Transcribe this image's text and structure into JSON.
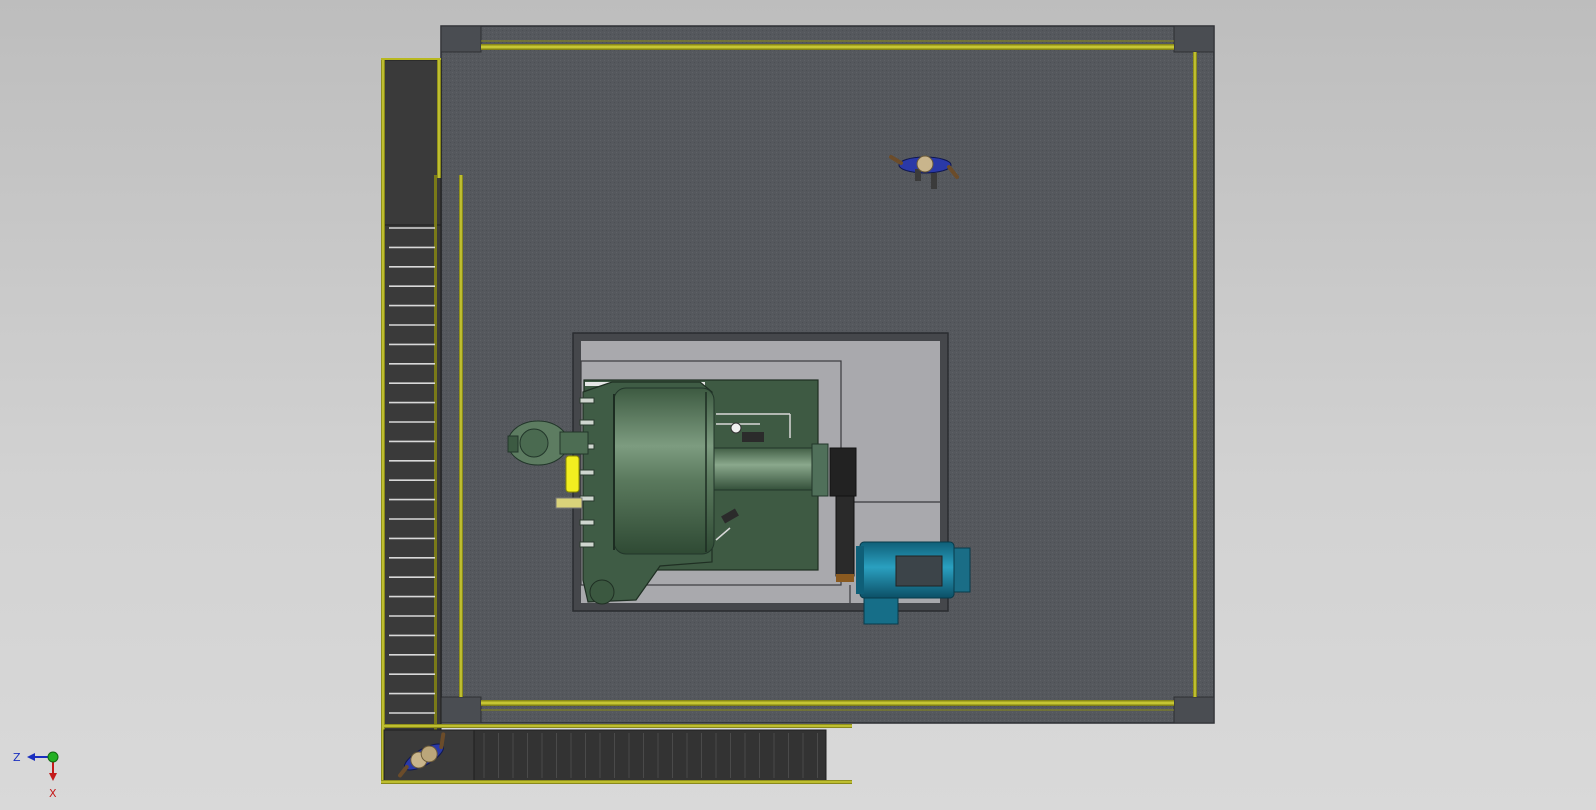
{
  "viewport": {
    "background_top": "#bdbdbd",
    "background_bottom": "#d9d9d9"
  },
  "triad": {
    "z_label": "Z",
    "x_label": "X",
    "z_color": "#1a2fbf",
    "x_color": "#c41a1a",
    "origin_color": "#22b022"
  },
  "colors": {
    "platform_floor": "#54575c",
    "railing": "#b8b820",
    "stair": "#3a3a3a",
    "vessel": "#4b6b50",
    "motor": "#1b7e99",
    "person_shirt": "#2a39a8"
  },
  "icons": [
    "person-figure-icon",
    "triad-icon"
  ]
}
